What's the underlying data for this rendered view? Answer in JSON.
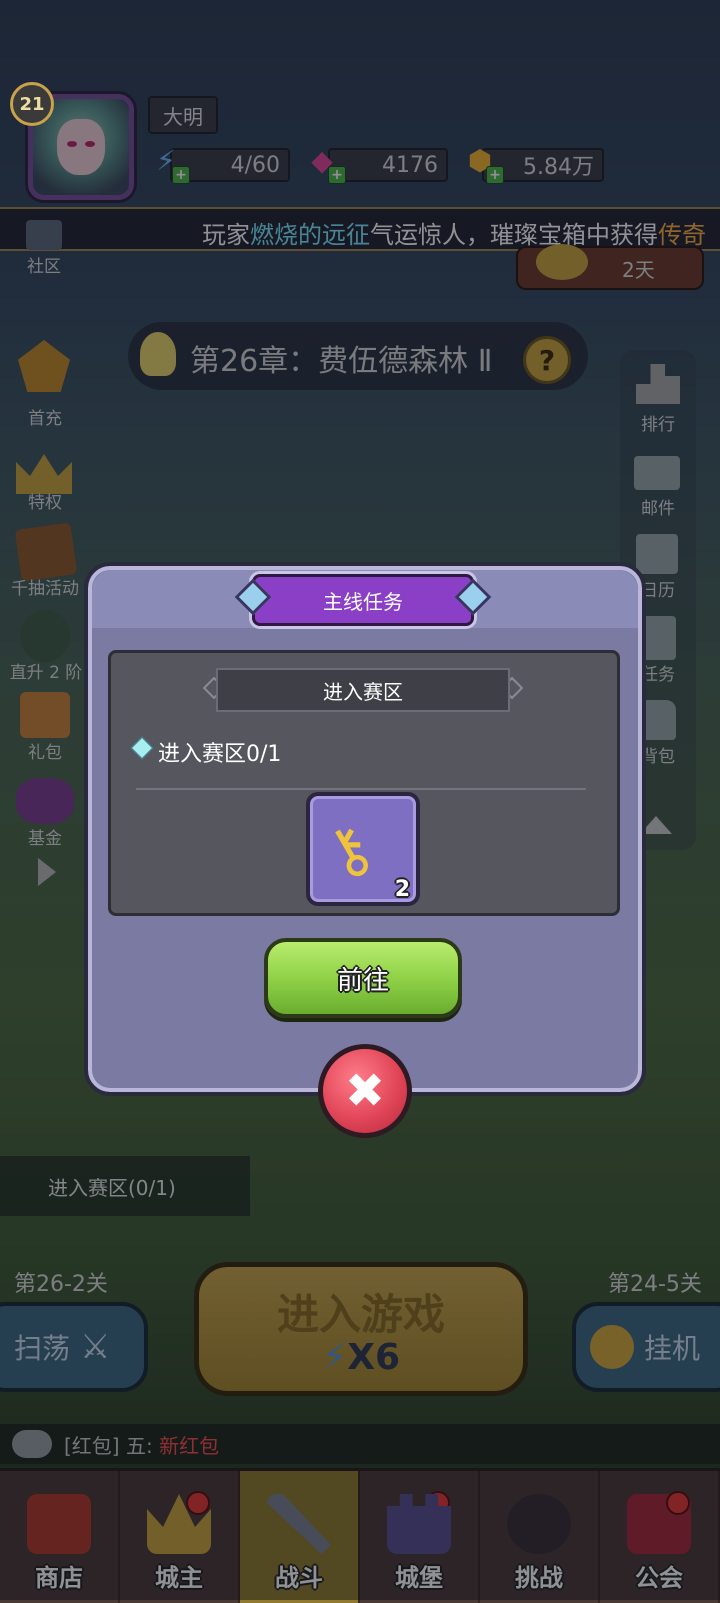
{
  "player": {
    "level": "21",
    "name": "大明",
    "energy": "4/60",
    "gems": "4176",
    "gold": "5.84万"
  },
  "marquee": {
    "prefix": "玩家",
    "player_name": "燃烧的远征",
    "middle": "气运惊人，璀璨宝箱中获得",
    "item": "传奇"
  },
  "top_left": {
    "community_label": "社区"
  },
  "event_timer": "2天",
  "chapter": {
    "title": "第26章：费伍德森林 Ⅱ"
  },
  "left_menu": [
    {
      "label": "首充",
      "icon": "first-recharge-icon"
    },
    {
      "label": "特权",
      "icon": "privilege-crown-icon"
    },
    {
      "label": "千抽活动",
      "icon": "card-draw-icon"
    },
    {
      "label": "直升 2 阶",
      "icon": "hero-upgrade-icon"
    },
    {
      "label": "礼包",
      "icon": "gift-box-icon"
    },
    {
      "label": "基金",
      "icon": "fund-icon"
    }
  ],
  "right_menu": [
    {
      "label": "排行",
      "icon": "ranking-icon"
    },
    {
      "label": "邮件",
      "icon": "mail-icon"
    },
    {
      "label": "日历",
      "icon": "calendar-icon"
    },
    {
      "label": "任务",
      "icon": "quest-scroll-icon"
    },
    {
      "label": "背包",
      "icon": "backpack-icon"
    }
  ],
  "modal": {
    "title": "主线任务",
    "subtitle": "进入赛区",
    "task_text": "进入赛区0/1",
    "reward": {
      "icon": "golden-key-icon",
      "count": "2"
    },
    "go_button": "前往",
    "close_icon": "close-x-icon"
  },
  "task_strip": "进入赛区(0/1)",
  "stages": {
    "left": "第26-2关",
    "right": "第24-5关"
  },
  "buttons": {
    "sweep": "扫荡",
    "idle": "挂机",
    "play": "进入游戏",
    "play_cost": "X6"
  },
  "chat": {
    "tag": "[红包]",
    "sender": "五:",
    "message": "新红包"
  },
  "nav": [
    {
      "label": "商店",
      "icon": "shop-stall-icon",
      "active": false,
      "badge": false
    },
    {
      "label": "城主",
      "icon": "lord-crown-icon",
      "active": false,
      "badge": true
    },
    {
      "label": "战斗",
      "icon": "crossed-swords-icon",
      "active": true,
      "badge": false
    },
    {
      "label": "城堡",
      "icon": "castle-icon",
      "active": false,
      "badge": true
    },
    {
      "label": "挑战",
      "icon": "demon-mask-icon",
      "active": false,
      "badge": false
    },
    {
      "label": "公会",
      "icon": "guild-book-icon",
      "active": false,
      "badge": true
    }
  ],
  "colors": {
    "modal_bg": "#7a7aa2",
    "title_ribbon": "#8a3fc6",
    "go_button": "#8ccf45",
    "close_button": "#e14658",
    "nav_active": "#8f7a2f",
    "marquee_highlight_player": "#7fe7ff",
    "marquee_highlight_item": "#ffb040"
  }
}
